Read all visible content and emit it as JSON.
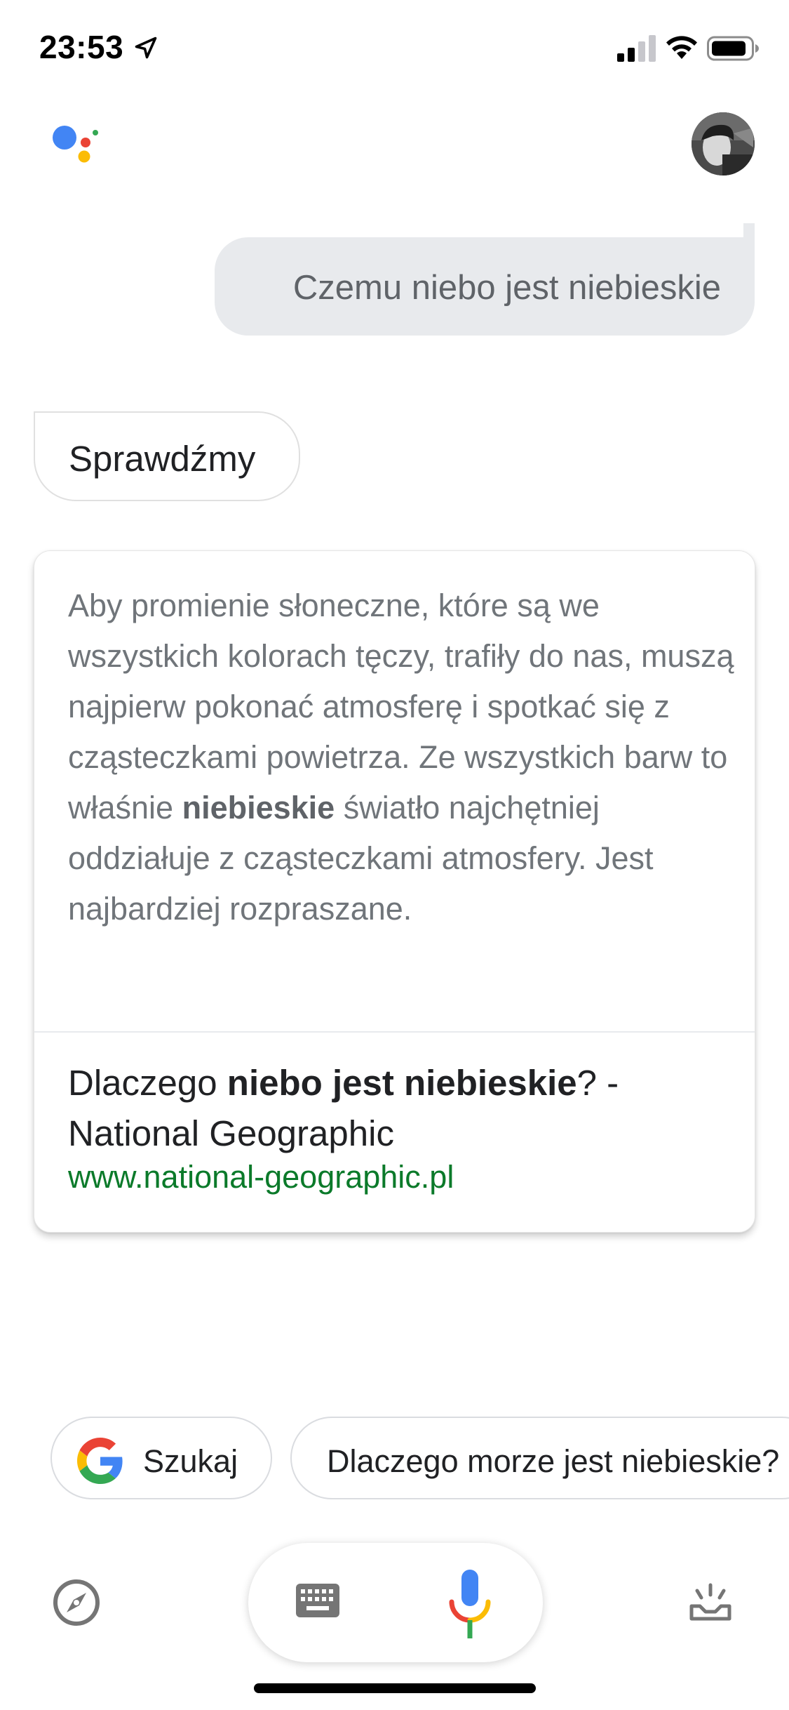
{
  "status_bar": {
    "time": "23:53"
  },
  "conversation": {
    "user_query": "Czemu niebo jest niebieskie",
    "assistant_reply": "Sprawdźmy"
  },
  "answer_card": {
    "text_before": "Aby promienie słoneczne, które są we wszystkich kolorach tęczy, trafiły do nas, muszą najpierw pokonać atmosferę i spotkać się z cząsteczkami powietrza. Ze wszystkich barw to właśnie ",
    "text_bold": "niebieskie",
    "text_after": " światło najchętniej oddziałuje z cząsteczkami atmosfery. Jest najbardziej rozpraszane.",
    "source_title_before": "Dlaczego ",
    "source_title_bold": "niebo jest niebieskie",
    "source_title_after": "? - National Geographic",
    "source_url": "www.national-geographic.pl"
  },
  "suggestions": [
    {
      "label": "Szukaj",
      "icon": "google-g-icon"
    },
    {
      "label": "Dlaczego morze jest niebieskie?"
    }
  ],
  "bottom_bar": {
    "icons": [
      "explore-icon",
      "keyboard-icon",
      "mic-icon",
      "updates-icon"
    ]
  },
  "colors": {
    "user_bubble": "#e8eaed",
    "url_green": "#0b7a2a",
    "google_blue": "#4285f4",
    "google_red": "#ea4335",
    "google_yellow": "#fbbc05",
    "google_green": "#34a853"
  }
}
